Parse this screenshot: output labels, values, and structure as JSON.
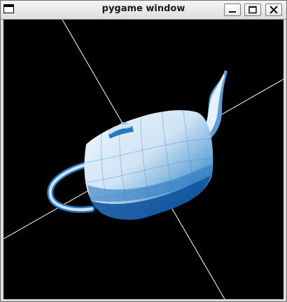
{
  "window": {
    "title": "pygame window",
    "controls": [
      "minimize",
      "maximize",
      "close"
    ],
    "icon": "window-icon"
  },
  "scene": {
    "object": "teapot",
    "background_color": "#000000",
    "axis_color": "#ffffff",
    "palette": [
      "#0b4f9a",
      "#2c78c0",
      "#5b9fd6",
      "#95c3e6",
      "#cfe3f4",
      "#f2f8fd"
    ]
  }
}
